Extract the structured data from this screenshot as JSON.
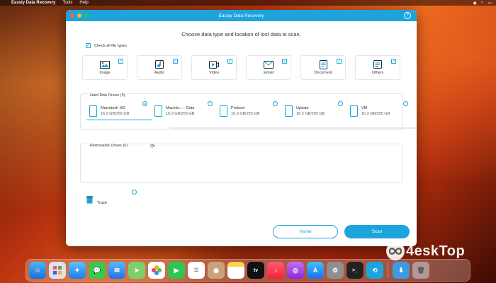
{
  "menubar": {
    "app_name": "Eassiy Data Recovery",
    "menus": [
      "Tools",
      "Help"
    ]
  },
  "window": {
    "title": "Eassiy Data Recovery",
    "help_icon": "?",
    "heading": "Choose data type and location of lost data to scan.",
    "check_all_label": "Check all file types",
    "file_types": [
      {
        "label": "Image",
        "icon": "image-icon",
        "checked": true
      },
      {
        "label": "Audio",
        "icon": "audio-icon",
        "checked": true
      },
      {
        "label": "Video",
        "icon": "video-icon",
        "checked": true
      },
      {
        "label": "Email",
        "icon": "email-icon",
        "checked": true
      },
      {
        "label": "Document",
        "icon": "document-icon",
        "checked": true
      },
      {
        "label": "Others",
        "icon": "others-icon",
        "checked": true
      }
    ],
    "hard_disk": {
      "title": "Hard Disk Drives (5)",
      "drives": [
        {
          "name": "Macintosh HD",
          "size": "16.3 GB/255 GB",
          "selected": true
        },
        {
          "name": "Macinto... - Data",
          "size": "16.3 GB/255 GB",
          "selected": false
        },
        {
          "name": "Preboot",
          "size": "16.3 GB/255 GB",
          "selected": false
        },
        {
          "name": "Update",
          "size": "16.3 GB/255 GB",
          "selected": false
        },
        {
          "name": "VM",
          "size": "16.3 GB/255 GB",
          "selected": false
        }
      ]
    },
    "removable": {
      "title": "Removable Drives (0)"
    },
    "trash_label": "Trash",
    "home_button": "Home",
    "scan_button": "Scan"
  },
  "watermark": {
    "text": "4eskTop"
  },
  "colors": {
    "accent": "#1ea4dc",
    "titlebar": "#1ea4dc"
  },
  "dock": {
    "apps": [
      "finder-icon",
      "launchpad-icon",
      "safari-icon",
      "messages-icon",
      "mail-icon",
      "maps-icon",
      "photos-icon",
      "facetime-icon",
      "reminders-icon",
      "contacts-icon",
      "notes-icon",
      "appletv-icon",
      "music-icon",
      "podcasts-icon",
      "appstore-icon",
      "settings-icon",
      "terminal-icon",
      "eassiy-icon"
    ]
  }
}
